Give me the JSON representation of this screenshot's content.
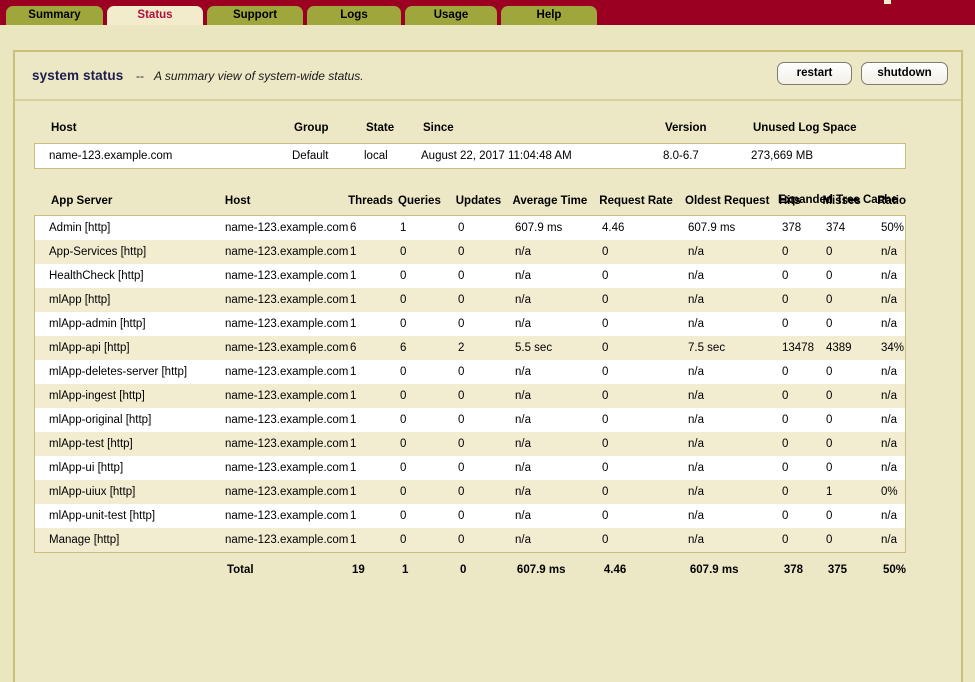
{
  "tabs": [
    {
      "label": "Summary",
      "active": false
    },
    {
      "label": "Status",
      "active": true
    },
    {
      "label": "Support",
      "active": false
    },
    {
      "label": "Logs",
      "active": false
    },
    {
      "label": "Usage",
      "active": false
    },
    {
      "label": "Help",
      "active": false
    }
  ],
  "header": {
    "title": "system status",
    "dash": "--",
    "subtitle": "A summary view of system-wide status.",
    "restart_label": "restart",
    "shutdown_label": "shutdown"
  },
  "hosts_table": {
    "columns": [
      "Host",
      "Group",
      "State",
      "Since",
      "Version",
      "Unused Log Space"
    ],
    "rows": [
      {
        "host": "name-123.example.com",
        "group": "Default",
        "state": "local",
        "since": "August 22, 2017 11:04:48 AM",
        "version": "8.0-6.7",
        "unused_log_space": "273,669 MB"
      }
    ]
  },
  "app_servers_table": {
    "group_header": "Expanded Tree Cache",
    "columns": [
      "App Server",
      "Host",
      "Threads",
      "Queries",
      "Updates",
      "Average Time",
      "Request Rate",
      "Oldest Request",
      "Hits",
      "Misses",
      "Ratio"
    ],
    "rows": [
      {
        "app": "Admin [http]",
        "host": "name-123.example.com",
        "threads": "6",
        "queries": "1",
        "updates": "0",
        "average_time": "607.9 ms",
        "request_rate": "4.46",
        "oldest_request": "607.9 ms",
        "hits": "378",
        "misses": "374",
        "ratio": "50%"
      },
      {
        "app": "App-Services [http]",
        "host": "name-123.example.com",
        "threads": "1",
        "queries": "0",
        "updates": "0",
        "average_time": "n/a",
        "request_rate": "0",
        "oldest_request": "n/a",
        "hits": "0",
        "misses": "0",
        "ratio": "n/a"
      },
      {
        "app": "HealthCheck [http]",
        "host": "name-123.example.com",
        "threads": "1",
        "queries": "0",
        "updates": "0",
        "average_time": "n/a",
        "request_rate": "0",
        "oldest_request": "n/a",
        "hits": "0",
        "misses": "0",
        "ratio": "n/a"
      },
      {
        "app": "mlApp [http]",
        "host": "name-123.example.com",
        "threads": "1",
        "queries": "0",
        "updates": "0",
        "average_time": "n/a",
        "request_rate": "0",
        "oldest_request": "n/a",
        "hits": "0",
        "misses": "0",
        "ratio": "n/a"
      },
      {
        "app": "mlApp-admin [http]",
        "host": "name-123.example.com",
        "threads": "1",
        "queries": "0",
        "updates": "0",
        "average_time": "n/a",
        "request_rate": "0",
        "oldest_request": "n/a",
        "hits": "0",
        "misses": "0",
        "ratio": "n/a"
      },
      {
        "app": "mlApp-api [http]",
        "host": "name-123.example.com",
        "threads": "6",
        "queries": "6",
        "updates": "2",
        "average_time": "5.5 sec",
        "request_rate": "0",
        "oldest_request": "7.5 sec",
        "hits": "13478",
        "misses": "4389",
        "ratio": "34%"
      },
      {
        "app": "mlApp-deletes-server [http]",
        "host": "name-123.example.com",
        "threads": "1",
        "queries": "0",
        "updates": "0",
        "average_time": "n/a",
        "request_rate": "0",
        "oldest_request": "n/a",
        "hits": "0",
        "misses": "0",
        "ratio": "n/a"
      },
      {
        "app": "mlApp-ingest [http]",
        "host": "name-123.example.com",
        "threads": "1",
        "queries": "0",
        "updates": "0",
        "average_time": "n/a",
        "request_rate": "0",
        "oldest_request": "n/a",
        "hits": "0",
        "misses": "0",
        "ratio": "n/a"
      },
      {
        "app": "mlApp-original [http]",
        "host": "name-123.example.com",
        "threads": "1",
        "queries": "0",
        "updates": "0",
        "average_time": "n/a",
        "request_rate": "0",
        "oldest_request": "n/a",
        "hits": "0",
        "misses": "0",
        "ratio": "n/a"
      },
      {
        "app": "mlApp-test [http]",
        "host": "name-123.example.com",
        "threads": "1",
        "queries": "0",
        "updates": "0",
        "average_time": "n/a",
        "request_rate": "0",
        "oldest_request": "n/a",
        "hits": "0",
        "misses": "0",
        "ratio": "n/a"
      },
      {
        "app": "mlApp-ui [http]",
        "host": "name-123.example.com",
        "threads": "1",
        "queries": "0",
        "updates": "0",
        "average_time": "n/a",
        "request_rate": "0",
        "oldest_request": "n/a",
        "hits": "0",
        "misses": "0",
        "ratio": "n/a"
      },
      {
        "app": "mlApp-uiux [http]",
        "host": "name-123.example.com",
        "threads": "1",
        "queries": "0",
        "updates": "0",
        "average_time": "n/a",
        "request_rate": "0",
        "oldest_request": "n/a",
        "hits": "0",
        "misses": "1",
        "ratio": "0%"
      },
      {
        "app": "mlApp-unit-test [http]",
        "host": "name-123.example.com",
        "threads": "1",
        "queries": "0",
        "updates": "0",
        "average_time": "n/a",
        "request_rate": "0",
        "oldest_request": "n/a",
        "hits": "0",
        "misses": "0",
        "ratio": "n/a"
      },
      {
        "app": "Manage [http]",
        "host": "name-123.example.com",
        "threads": "1",
        "queries": "0",
        "updates": "0",
        "average_time": "n/a",
        "request_rate": "0",
        "oldest_request": "n/a",
        "hits": "0",
        "misses": "0",
        "ratio": "n/a"
      }
    ],
    "total": {
      "app": "",
      "host": "Total",
      "threads": "19",
      "queries": "1",
      "updates": "0",
      "average_time": "607.9 ms",
      "request_rate": "4.46",
      "oldest_request": "607.9 ms",
      "hits": "378",
      "misses": "375",
      "ratio": "50%"
    }
  },
  "colors": {
    "tabbar_bg": "#9b0022",
    "tab_bg": "#9fa63c",
    "tab_active_bg": "#f2eccd",
    "tab_active_text": "#b2103c",
    "page_bg": "#eae6c0",
    "row_even": "#f2ecd0",
    "row_odd": "#ffffff",
    "title_color": "#1d1d4e"
  }
}
